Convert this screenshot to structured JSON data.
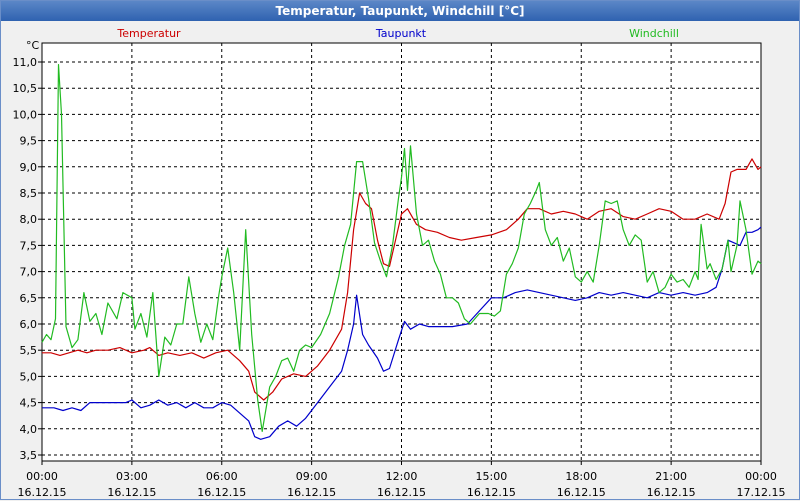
{
  "window": {
    "title": "Temperatur, Taupunkt, Windchill [°C]"
  },
  "colors": {
    "temperatur": "#cc0000",
    "taupunkt": "#0000cc",
    "windchill": "#22bb22",
    "grid": "#000000"
  },
  "chart_data": {
    "type": "line",
    "title": "Temperatur, Taupunkt, Windchill [°C]",
    "ylabel": "°C",
    "ylim": [
      3.5,
      11.0
    ],
    "grid": true,
    "legend": "top",
    "y_ticks": [
      "11,0",
      "10,5",
      "10,0",
      "9,5",
      "9,0",
      "8,5",
      "8,0",
      "7,5",
      "7,0",
      "6,5",
      "6,0",
      "5,5",
      "5,0",
      "4,5",
      "4,0",
      "3,5"
    ],
    "x_ticks": [
      {
        "time": "00:00",
        "date": "16.12.15"
      },
      {
        "time": "03:00",
        "date": "16.12.15"
      },
      {
        "time": "06:00",
        "date": "16.12.15"
      },
      {
        "time": "09:00",
        "date": "16.12.15"
      },
      {
        "time": "12:00",
        "date": "16.12.15"
      },
      {
        "time": "15:00",
        "date": "16.12.15"
      },
      {
        "time": "18:00",
        "date": "16.12.15"
      },
      {
        "time": "21:00",
        "date": "16.12.15"
      },
      {
        "time": "00:00",
        "date": "17.12.15"
      }
    ],
    "xlim_hours": [
      0,
      24
    ],
    "series": [
      {
        "name": "Temperatur",
        "color": "#cc0000",
        "points": [
          [
            0,
            5.45
          ],
          [
            0.3,
            5.45
          ],
          [
            0.6,
            5.4
          ],
          [
            0.9,
            5.45
          ],
          [
            1.2,
            5.5
          ],
          [
            1.5,
            5.45
          ],
          [
            1.8,
            5.5
          ],
          [
            2.2,
            5.5
          ],
          [
            2.6,
            5.55
          ],
          [
            3.0,
            5.45
          ],
          [
            3.4,
            5.5
          ],
          [
            3.6,
            5.55
          ],
          [
            3.9,
            5.4
          ],
          [
            4.2,
            5.45
          ],
          [
            4.6,
            5.4
          ],
          [
            5.0,
            5.45
          ],
          [
            5.4,
            5.35
          ],
          [
            5.8,
            5.45
          ],
          [
            6.2,
            5.5
          ],
          [
            6.6,
            5.3
          ],
          [
            6.9,
            5.1
          ],
          [
            7.1,
            4.7
          ],
          [
            7.4,
            4.55
          ],
          [
            7.7,
            4.7
          ],
          [
            8.0,
            4.95
          ],
          [
            8.4,
            5.05
          ],
          [
            8.8,
            5.0
          ],
          [
            9.2,
            5.2
          ],
          [
            9.6,
            5.5
          ],
          [
            10.0,
            5.9
          ],
          [
            10.2,
            6.6
          ],
          [
            10.4,
            7.8
          ],
          [
            10.6,
            8.5
          ],
          [
            10.8,
            8.3
          ],
          [
            11.0,
            8.2
          ],
          [
            11.2,
            7.6
          ],
          [
            11.4,
            7.15
          ],
          [
            11.6,
            7.1
          ],
          [
            11.8,
            7.6
          ],
          [
            12.0,
            8.1
          ],
          [
            12.2,
            8.2
          ],
          [
            12.5,
            7.9
          ],
          [
            12.8,
            7.8
          ],
          [
            13.2,
            7.75
          ],
          [
            13.6,
            7.65
          ],
          [
            14.0,
            7.6
          ],
          [
            14.5,
            7.65
          ],
          [
            15.0,
            7.7
          ],
          [
            15.5,
            7.8
          ],
          [
            15.9,
            8.0
          ],
          [
            16.2,
            8.2
          ],
          [
            16.6,
            8.2
          ],
          [
            17.0,
            8.1
          ],
          [
            17.4,
            8.15
          ],
          [
            17.8,
            8.1
          ],
          [
            18.2,
            8.0
          ],
          [
            18.6,
            8.15
          ],
          [
            19.0,
            8.2
          ],
          [
            19.4,
            8.05
          ],
          [
            19.8,
            8.0
          ],
          [
            20.2,
            8.1
          ],
          [
            20.6,
            8.2
          ],
          [
            21.0,
            8.15
          ],
          [
            21.4,
            8.0
          ],
          [
            21.8,
            8.0
          ],
          [
            22.2,
            8.1
          ],
          [
            22.6,
            8.0
          ],
          [
            22.8,
            8.3
          ],
          [
            23.0,
            8.9
          ],
          [
            23.2,
            8.95
          ],
          [
            23.5,
            8.95
          ],
          [
            23.7,
            9.15
          ],
          [
            23.9,
            8.95
          ],
          [
            24.0,
            9.0
          ]
        ]
      },
      {
        "name": "Taupunkt",
        "color": "#0000cc",
        "points": [
          [
            0,
            4.4
          ],
          [
            0.4,
            4.4
          ],
          [
            0.7,
            4.35
          ],
          [
            1.0,
            4.4
          ],
          [
            1.3,
            4.35
          ],
          [
            1.6,
            4.5
          ],
          [
            2.0,
            4.5
          ],
          [
            2.4,
            4.5
          ],
          [
            2.8,
            4.5
          ],
          [
            3.0,
            4.55
          ],
          [
            3.3,
            4.4
          ],
          [
            3.6,
            4.45
          ],
          [
            3.9,
            4.55
          ],
          [
            4.2,
            4.45
          ],
          [
            4.5,
            4.5
          ],
          [
            4.8,
            4.4
          ],
          [
            5.1,
            4.5
          ],
          [
            5.4,
            4.4
          ],
          [
            5.7,
            4.4
          ],
          [
            6.0,
            4.5
          ],
          [
            6.3,
            4.45
          ],
          [
            6.6,
            4.3
          ],
          [
            6.9,
            4.15
          ],
          [
            7.1,
            3.85
          ],
          [
            7.3,
            3.8
          ],
          [
            7.6,
            3.85
          ],
          [
            7.9,
            4.05
          ],
          [
            8.2,
            4.15
          ],
          [
            8.5,
            4.05
          ],
          [
            8.8,
            4.2
          ],
          [
            9.2,
            4.5
          ],
          [
            9.6,
            4.8
          ],
          [
            10.0,
            5.1
          ],
          [
            10.2,
            5.5
          ],
          [
            10.4,
            6.0
          ],
          [
            10.5,
            6.55
          ],
          [
            10.7,
            5.8
          ],
          [
            10.9,
            5.6
          ],
          [
            11.2,
            5.35
          ],
          [
            11.4,
            5.1
          ],
          [
            11.6,
            5.15
          ],
          [
            11.9,
            5.7
          ],
          [
            12.1,
            6.05
          ],
          [
            12.3,
            5.9
          ],
          [
            12.6,
            6.0
          ],
          [
            12.9,
            5.95
          ],
          [
            13.3,
            5.95
          ],
          [
            13.7,
            5.95
          ],
          [
            14.2,
            6.0
          ],
          [
            14.6,
            6.25
          ],
          [
            15.0,
            6.5
          ],
          [
            15.4,
            6.5
          ],
          [
            15.8,
            6.6
          ],
          [
            16.2,
            6.65
          ],
          [
            16.6,
            6.6
          ],
          [
            17.0,
            6.55
          ],
          [
            17.4,
            6.5
          ],
          [
            17.8,
            6.45
          ],
          [
            18.2,
            6.5
          ],
          [
            18.6,
            6.6
          ],
          [
            19.0,
            6.55
          ],
          [
            19.4,
            6.6
          ],
          [
            19.8,
            6.55
          ],
          [
            20.2,
            6.5
          ],
          [
            20.6,
            6.6
          ],
          [
            21.0,
            6.55
          ],
          [
            21.4,
            6.6
          ],
          [
            21.8,
            6.55
          ],
          [
            22.2,
            6.6
          ],
          [
            22.5,
            6.7
          ],
          [
            22.7,
            7.05
          ],
          [
            22.9,
            7.6
          ],
          [
            23.1,
            7.55
          ],
          [
            23.3,
            7.5
          ],
          [
            23.5,
            7.75
          ],
          [
            23.7,
            7.75
          ],
          [
            23.9,
            7.8
          ],
          [
            24.0,
            7.85
          ]
        ]
      },
      {
        "name": "Windchill",
        "color": "#22bb22",
        "points": [
          [
            0,
            5.65
          ],
          [
            0.15,
            5.8
          ],
          [
            0.3,
            5.7
          ],
          [
            0.45,
            6.1
          ],
          [
            0.55,
            10.95
          ],
          [
            0.65,
            10.0
          ],
          [
            0.8,
            5.95
          ],
          [
            1.0,
            5.55
          ],
          [
            1.2,
            5.7
          ],
          [
            1.4,
            6.6
          ],
          [
            1.6,
            6.05
          ],
          [
            1.8,
            6.2
          ],
          [
            2.0,
            5.8
          ],
          [
            2.2,
            6.4
          ],
          [
            2.5,
            6.1
          ],
          [
            2.7,
            6.6
          ],
          [
            3.0,
            6.5
          ],
          [
            3.1,
            5.9
          ],
          [
            3.3,
            6.2
          ],
          [
            3.5,
            5.75
          ],
          [
            3.7,
            6.6
          ],
          [
            3.9,
            5.0
          ],
          [
            4.1,
            5.75
          ],
          [
            4.3,
            5.6
          ],
          [
            4.5,
            6.0
          ],
          [
            4.7,
            6.0
          ],
          [
            4.9,
            6.9
          ],
          [
            5.1,
            6.2
          ],
          [
            5.3,
            5.65
          ],
          [
            5.5,
            6.0
          ],
          [
            5.7,
            5.7
          ],
          [
            5.9,
            6.55
          ],
          [
            6.0,
            6.9
          ],
          [
            6.2,
            7.45
          ],
          [
            6.4,
            6.6
          ],
          [
            6.6,
            5.5
          ],
          [
            6.8,
            7.8
          ],
          [
            7.0,
            5.8
          ],
          [
            7.2,
            4.55
          ],
          [
            7.35,
            3.95
          ],
          [
            7.6,
            4.8
          ],
          [
            7.8,
            5.0
          ],
          [
            8.0,
            5.3
          ],
          [
            8.2,
            5.35
          ],
          [
            8.4,
            5.1
          ],
          [
            8.6,
            5.5
          ],
          [
            8.8,
            5.6
          ],
          [
            9.0,
            5.55
          ],
          [
            9.3,
            5.8
          ],
          [
            9.6,
            6.2
          ],
          [
            9.9,
            6.9
          ],
          [
            10.1,
            7.5
          ],
          [
            10.3,
            7.9
          ],
          [
            10.5,
            9.1
          ],
          [
            10.7,
            9.1
          ],
          [
            10.9,
            8.4
          ],
          [
            11.1,
            7.55
          ],
          [
            11.3,
            7.2
          ],
          [
            11.5,
            6.9
          ],
          [
            11.7,
            7.5
          ],
          [
            11.9,
            8.4
          ],
          [
            12.0,
            8.8
          ],
          [
            12.1,
            9.35
          ],
          [
            12.2,
            8.55
          ],
          [
            12.3,
            9.4
          ],
          [
            12.5,
            8.1
          ],
          [
            12.7,
            7.5
          ],
          [
            12.9,
            7.6
          ],
          [
            13.1,
            7.2
          ],
          [
            13.3,
            6.95
          ],
          [
            13.5,
            6.5
          ],
          [
            13.7,
            6.5
          ],
          [
            13.9,
            6.4
          ],
          [
            14.1,
            6.1
          ],
          [
            14.3,
            6.0
          ],
          [
            14.6,
            6.2
          ],
          [
            14.9,
            6.2
          ],
          [
            15.1,
            6.15
          ],
          [
            15.3,
            6.25
          ],
          [
            15.5,
            6.95
          ],
          [
            15.7,
            7.15
          ],
          [
            15.9,
            7.45
          ],
          [
            16.1,
            8.1
          ],
          [
            16.3,
            8.3
          ],
          [
            16.5,
            8.55
          ],
          [
            16.6,
            8.7
          ],
          [
            16.8,
            7.8
          ],
          [
            17.0,
            7.5
          ],
          [
            17.2,
            7.65
          ],
          [
            17.4,
            7.2
          ],
          [
            17.6,
            7.45
          ],
          [
            17.8,
            6.9
          ],
          [
            18.0,
            6.8
          ],
          [
            18.2,
            7.0
          ],
          [
            18.4,
            6.8
          ],
          [
            18.6,
            7.5
          ],
          [
            18.8,
            8.35
          ],
          [
            19.0,
            8.3
          ],
          [
            19.2,
            8.35
          ],
          [
            19.4,
            7.8
          ],
          [
            19.6,
            7.5
          ],
          [
            19.8,
            7.7
          ],
          [
            20.0,
            7.6
          ],
          [
            20.2,
            6.8
          ],
          [
            20.4,
            7.0
          ],
          [
            20.6,
            6.6
          ],
          [
            20.8,
            6.7
          ],
          [
            21.0,
            6.95
          ],
          [
            21.2,
            6.8
          ],
          [
            21.4,
            6.85
          ],
          [
            21.6,
            6.7
          ],
          [
            21.8,
            7.0
          ],
          [
            21.9,
            6.85
          ],
          [
            22.0,
            7.9
          ],
          [
            22.2,
            7.05
          ],
          [
            22.3,
            7.15
          ],
          [
            22.5,
            6.85
          ],
          [
            22.7,
            7.05
          ],
          [
            22.9,
            7.6
          ],
          [
            23.0,
            7.0
          ],
          [
            23.2,
            7.5
          ],
          [
            23.3,
            8.35
          ],
          [
            23.5,
            7.8
          ],
          [
            23.7,
            6.95
          ],
          [
            23.9,
            7.2
          ],
          [
            24.0,
            7.15
          ]
        ]
      }
    ]
  }
}
